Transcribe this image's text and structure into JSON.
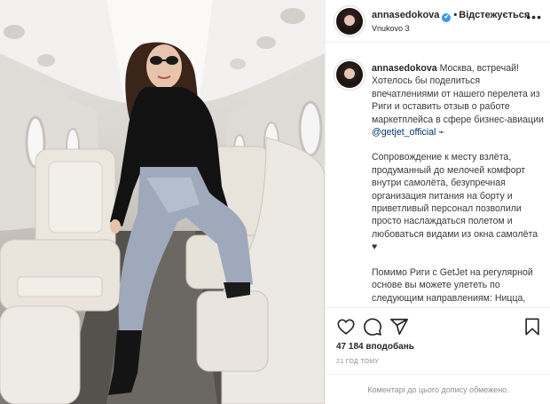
{
  "post": {
    "username": "annasedokova",
    "verified_mark": "✔",
    "separator": "•",
    "follow_label": "Відстежується",
    "location": "Vnukovo 3",
    "more_icon": "more-horizontal-icon"
  },
  "caption": {
    "username": "annasedokova",
    "para1_a": "Москва, встречай! Хотелось бы поделиться впечатлениями от нашего перелета из Риги и оставить отзыв о работе маркетплейса в сфере бизнес-авиации ",
    "mention": "@getjet_official",
    "emoji": " ⌁",
    "para2": "Сопровождение к месту взлёта, продуманный до мелочей комфорт внутри самолёта, безупречная организация питания на борту и приветливый персонал позволили просто наслаждаться полетом и любоваться видами из окна самолёта ♥",
    "para3": "Помимо Риги с GetJet на регулярной основе вы можете улететь по следующим направлениям: Ницца, Лондон,"
  },
  "actions": {
    "like_icon": "heart-icon",
    "comment_icon": "comment-icon",
    "share_icon": "send-icon",
    "save_icon": "bookmark-icon"
  },
  "stats": {
    "likes": "47 184 вподобань",
    "time": "21 ГОД ТОМУ"
  },
  "comments": {
    "disabled_text": "Коментарі до цього допису обмежено."
  },
  "colors": {
    "verified": "#3897f0",
    "mention": "#00376b",
    "border": "#efefef",
    "muted": "#8e8e8e"
  }
}
